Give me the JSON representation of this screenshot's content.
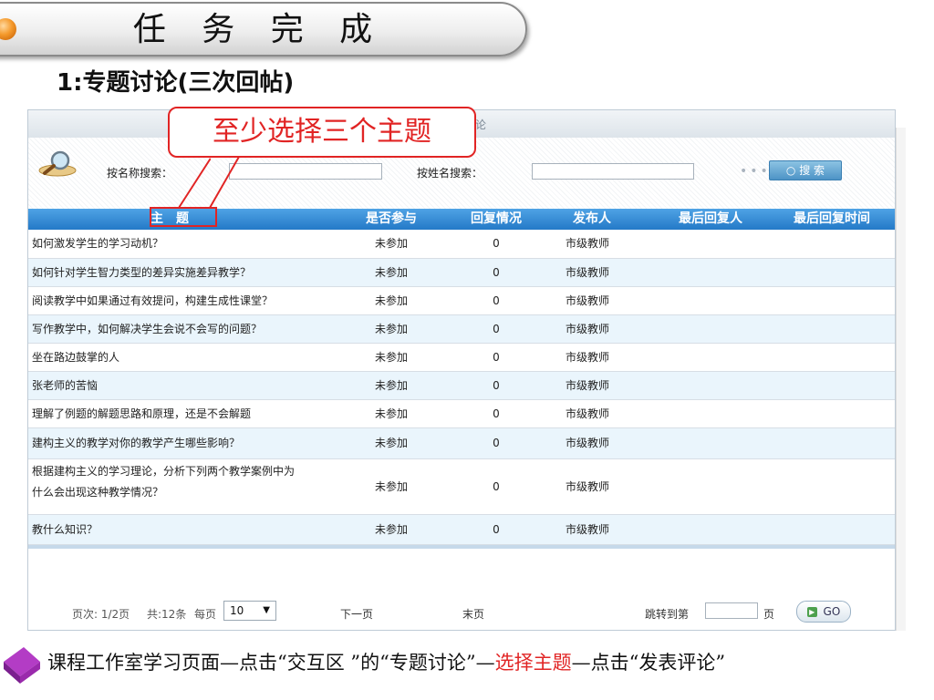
{
  "slide": {
    "title": "任 务 完 成",
    "subtitle": "1:专题讨论(三次回帖)"
  },
  "panel": {
    "topbar_text": "论",
    "search": {
      "name_label": "按名称搜索：",
      "author_label": "按姓名搜索：",
      "button_label": "搜 索"
    },
    "table": {
      "headers": [
        "主　题",
        "是否参与",
        "回复情况",
        "发布人",
        "最后回复人",
        "最后回复时间"
      ],
      "rows": [
        {
          "topic": "如何激发学生的学习动机？",
          "participated": "未参加",
          "replies": "0",
          "publisher": "市级教师"
        },
        {
          "topic": "如何针对学生智力类型的差异实施差异教学？",
          "participated": "未参加",
          "replies": "0",
          "publisher": "市级教师"
        },
        {
          "topic": "阅读教学中如果通过有效提问，构建生成性课堂？",
          "participated": "未参加",
          "replies": "0",
          "publisher": "市级教师"
        },
        {
          "topic": "写作教学中，如何解决学生会说不会写的问题？",
          "participated": "未参加",
          "replies": "0",
          "publisher": "市级教师"
        },
        {
          "topic": "坐在路边鼓掌的人",
          "participated": "未参加",
          "replies": "0",
          "publisher": "市级教师"
        },
        {
          "topic": "张老师的苦恼",
          "participated": "未参加",
          "replies": "0",
          "publisher": "市级教师"
        },
        {
          "topic": "理解了例题的解题思路和原理，还是不会解题",
          "participated": "未参加",
          "replies": "0",
          "publisher": "市级教师"
        },
        {
          "topic": "建构主义的教学对你的教学产生哪些影响？",
          "participated": "未参加",
          "replies": "0",
          "publisher": "市级教师"
        },
        {
          "topic_line1": "根据建构主义的学习理论，分析下列两个教学案例中为",
          "topic_line2": "什么会出现这种教学情况？",
          "participated": "未参加",
          "replies": "0",
          "publisher": "市级教师"
        },
        {
          "topic": "教什么知识？",
          "participated": "未参加",
          "replies": "0",
          "publisher": "市级教师"
        }
      ]
    },
    "pager": {
      "page_info": "页次: 1/2页",
      "total": "共:12条",
      "per_page_label": "每页",
      "per_page_value": "10",
      "next": "下一页",
      "last": "末页",
      "jump_label": "跳转到第",
      "jump_suffix": "页",
      "go_label": "GO"
    }
  },
  "callout": {
    "text": "至少选择三个主题"
  },
  "footer": {
    "part1": "课程工作室学习页面—点击“交互区 ”的“专题讨论”—",
    "highlight": "选择主题",
    "part2": "—点击“发表评论”"
  },
  "colors": {
    "accent_red": "#e12424",
    "table_header": "#2f86d4",
    "row_alt": "#eaf5fc",
    "search_button": "#4d93c6"
  }
}
